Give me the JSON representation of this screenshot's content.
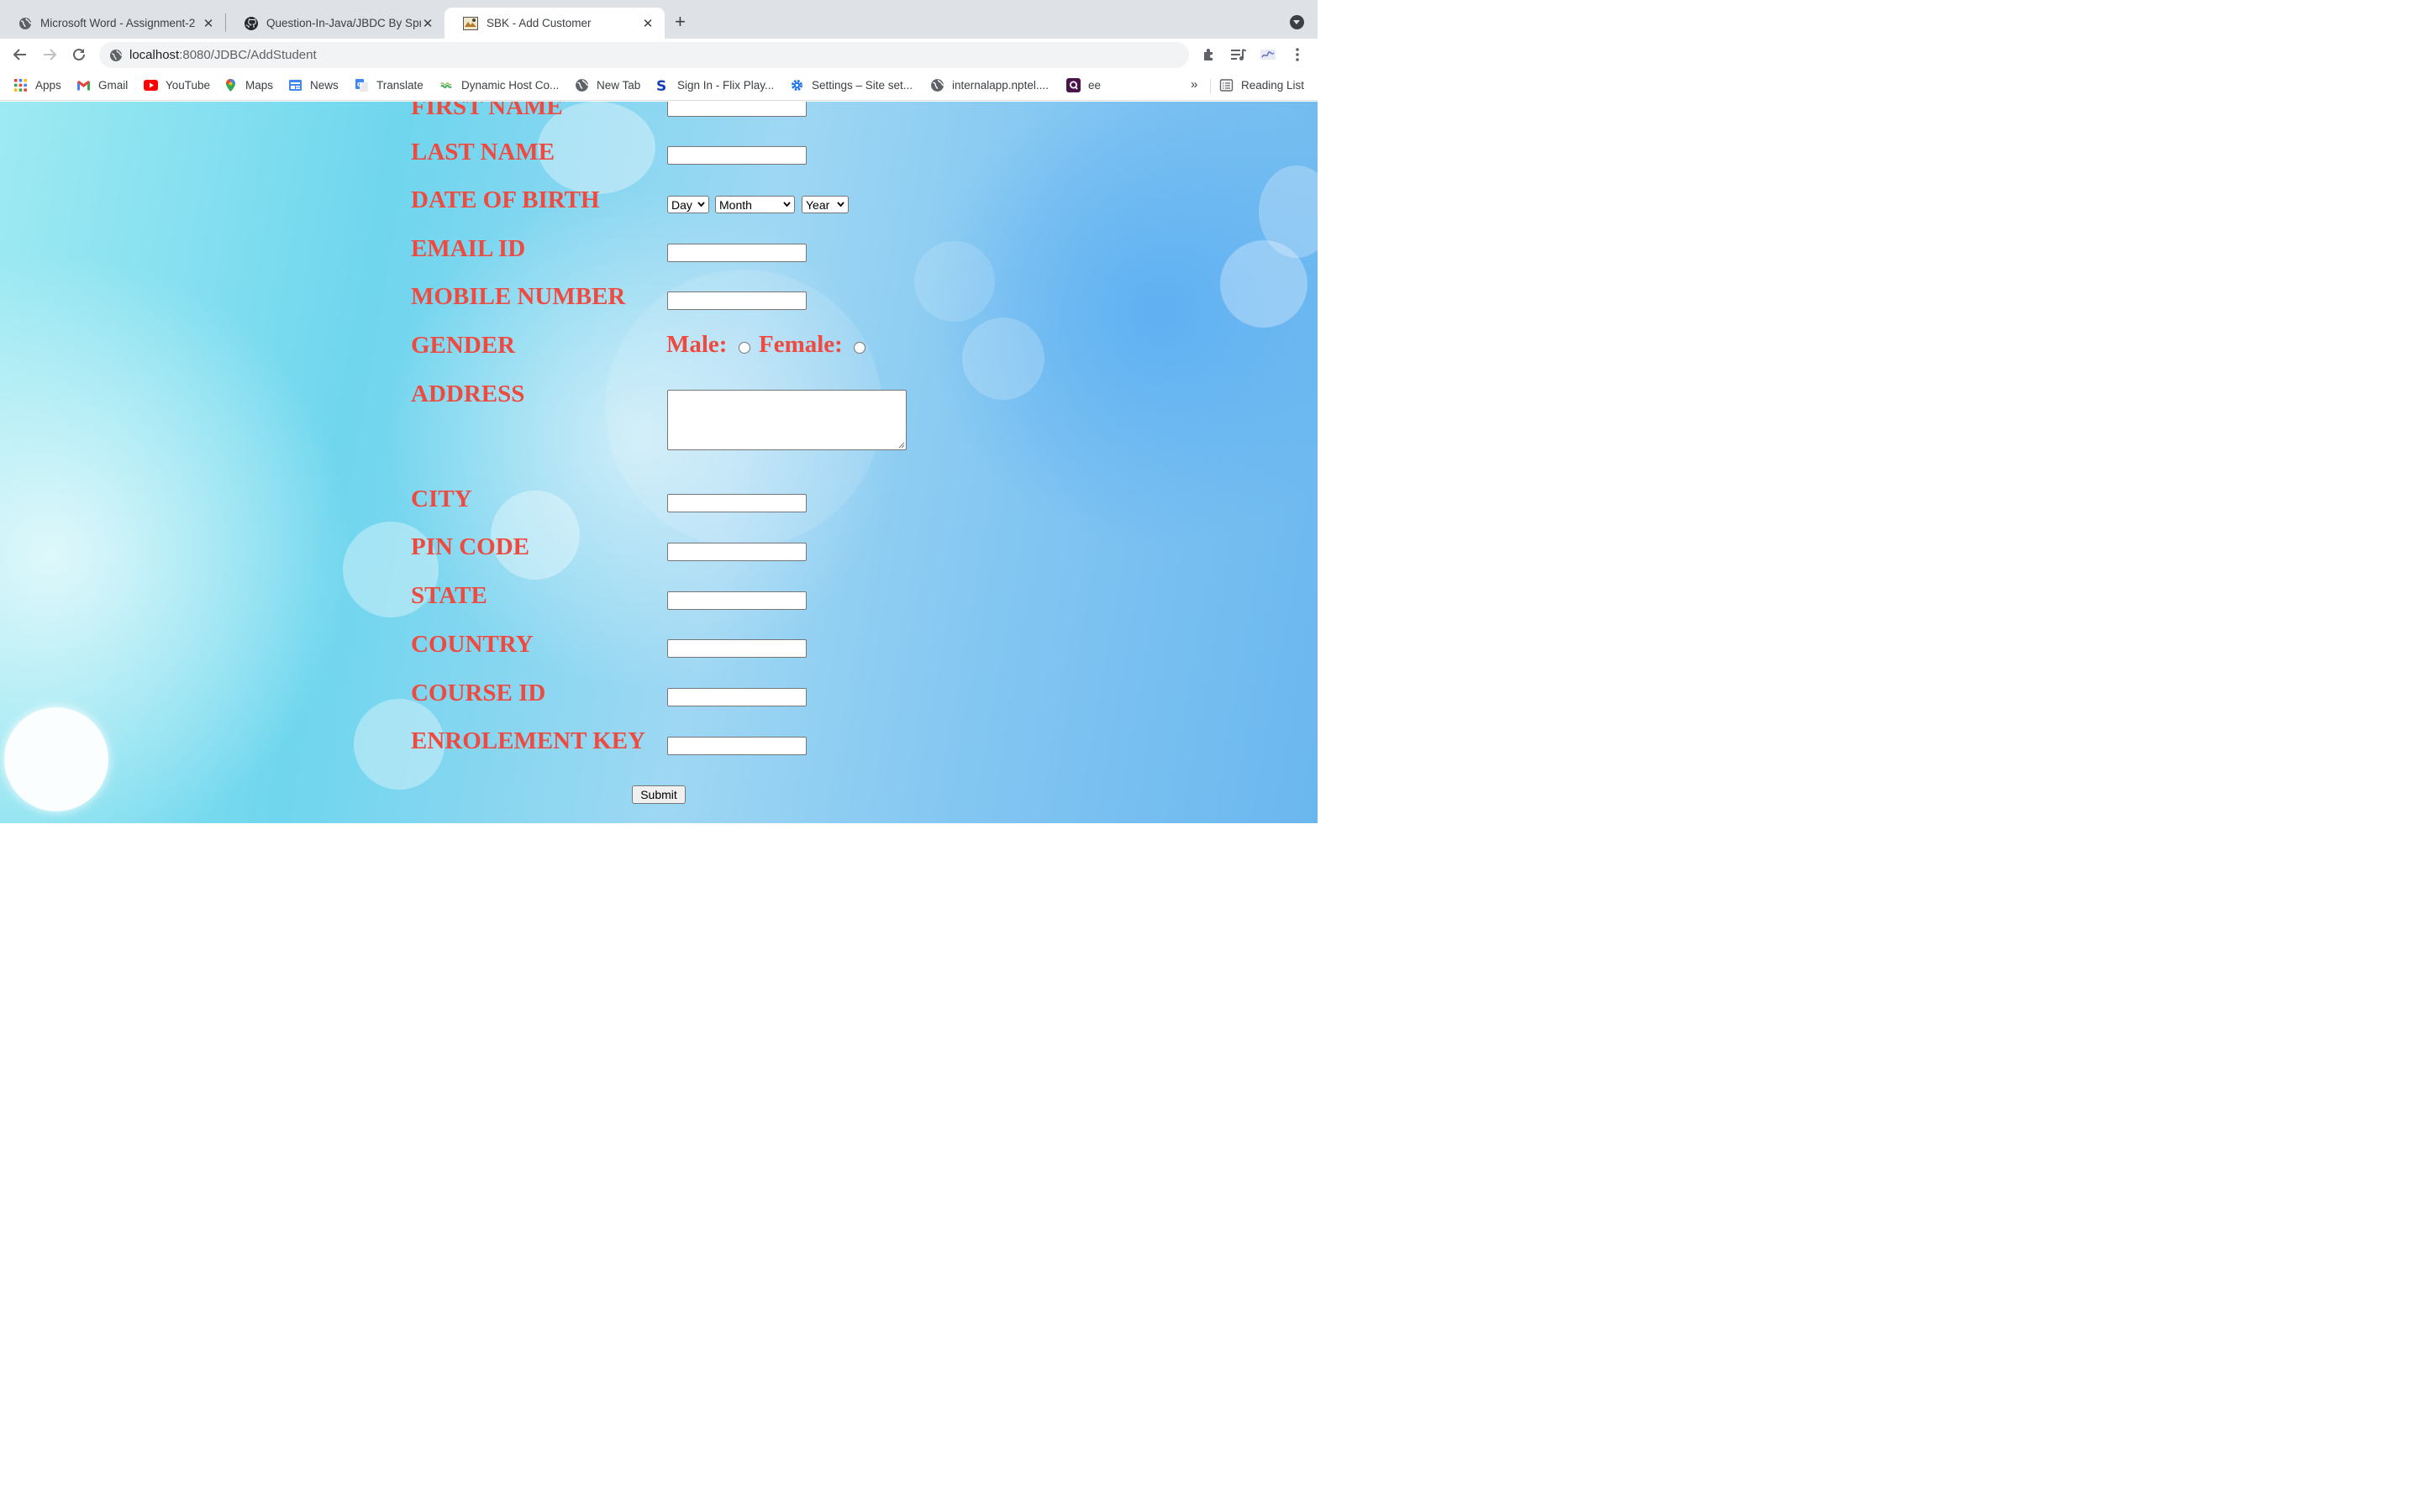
{
  "tabs": [
    {
      "title": "Microsoft Word - Assignment-2",
      "icon": "globe-icon",
      "active": false
    },
    {
      "title": "Question-In-Java/JBDC By Spring",
      "icon": "github-icon",
      "active": false
    },
    {
      "title": "SBK - Add Customer",
      "icon": "page-favicon-icon",
      "active": true
    }
  ],
  "toolbar": {
    "url_host": "localhost",
    "url_path": ":8080/JDBC/AddStudent"
  },
  "bookmarks": [
    {
      "label": "Apps",
      "icon": "apps-grid-icon"
    },
    {
      "label": "Gmail",
      "icon": "gmail-icon"
    },
    {
      "label": "YouTube",
      "icon": "youtube-icon"
    },
    {
      "label": "Maps",
      "icon": "maps-icon"
    },
    {
      "label": "News",
      "icon": "news-icon"
    },
    {
      "label": "Translate",
      "icon": "translate-icon"
    },
    {
      "label": "Dynamic Host Co...",
      "icon": "dynamic-host-icon"
    },
    {
      "label": "New Tab",
      "icon": "globe-icon"
    },
    {
      "label": "Sign In - Flix Play...",
      "icon": "flix-icon"
    },
    {
      "label": "Settings – Site set...",
      "icon": "gear-icon"
    },
    {
      "label": "internalapp.nptel....",
      "icon": "globe-icon"
    },
    {
      "label": "ee",
      "icon": "ee-icon"
    }
  ],
  "bookmarks_overflow": "»",
  "reading_list": "Reading List",
  "form": {
    "first_name": "FIRST NAME",
    "last_name": "LAST NAME",
    "date_of_birth": "DATE OF BIRTH",
    "dob_day": "Day",
    "dob_month": "Month",
    "dob_year": "Year",
    "email_id": "EMAIL ID",
    "mobile_number": "MOBILE NUMBER",
    "gender": "GENDER",
    "male": "Male:",
    "female": "Female:",
    "address": "ADDRESS",
    "city": "CITY",
    "pin_code": "PIN CODE",
    "state": "STATE",
    "country": "COUNTRY",
    "course_id": "COURSE ID",
    "enrolement_key": "ENROLEMENT KEY",
    "submit": "Submit"
  },
  "colors": {
    "label": "#ef4a3f",
    "tabstrip": "#dee1e6"
  }
}
